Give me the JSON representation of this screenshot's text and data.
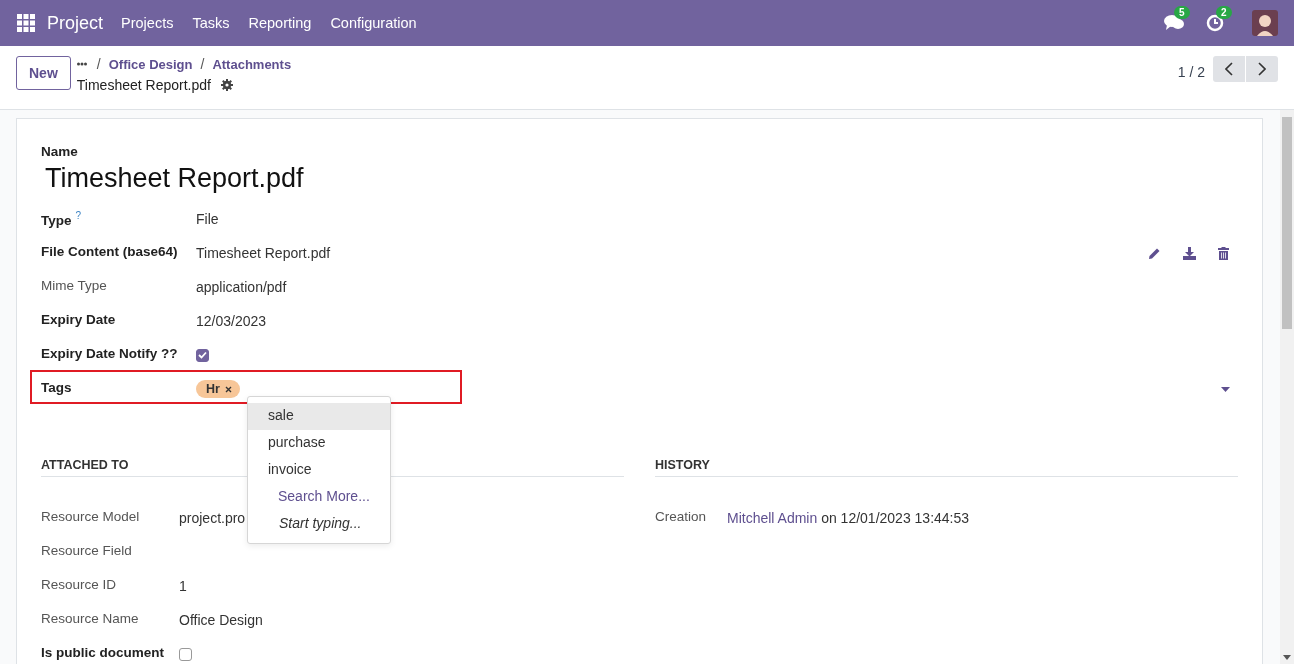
{
  "navbar": {
    "app": "Project",
    "menu": [
      "Projects",
      "Tasks",
      "Reporting",
      "Configuration"
    ],
    "messages_count": "5",
    "activities_count": "2"
  },
  "control_panel": {
    "new_button": "New",
    "breadcrumbs": [
      {
        "separator": "/",
        "label": "Office Design"
      },
      {
        "separator": "/",
        "label": "Attachments"
      }
    ],
    "record_title": "Timesheet Report.pdf",
    "pager": "1 / 2"
  },
  "form": {
    "name_label": "Name",
    "name": "Timesheet Report.pdf",
    "fields": [
      {
        "kind": "text",
        "label": "Type",
        "help": "?",
        "value": "File",
        "readonly": false
      },
      {
        "kind": "binary",
        "label": "File Content (base64)",
        "value": "Timesheet Report.pdf",
        "readonly": false
      },
      {
        "kind": "text",
        "label": "Mime Type",
        "value": "application/pdf",
        "readonly": true
      },
      {
        "kind": "text",
        "label": "Expiry Date",
        "value": "12/03/2023",
        "readonly": false
      },
      {
        "kind": "checkbox",
        "label": "Expiry Date Notify ??",
        "checked": true,
        "readonly": false
      },
      {
        "kind": "tags",
        "label": "Tags",
        "tags": [
          {
            "label": "Hr",
            "color": "#f7c698"
          }
        ],
        "highlighted": true,
        "readonly": false
      }
    ],
    "sections": [
      {
        "title": "ATTACHED TO",
        "fields": [
          {
            "kind": "text",
            "label": "Resource Model",
            "value": "project.pro",
            "readonly": true
          },
          {
            "kind": "text",
            "label": "Resource Field",
            "readonly": true
          },
          {
            "kind": "text",
            "label": "Resource ID",
            "value": "1",
            "readonly": true
          },
          {
            "kind": "text",
            "label": "Resource Name",
            "value": "Office Design",
            "readonly": true
          },
          {
            "kind": "checkbox",
            "label": "Is public document",
            "checked": false,
            "readonly": false
          }
        ]
      },
      {
        "title": "HISTORY",
        "fields": [
          {
            "kind": "creation",
            "label": "Creation",
            "user": "Mitchell Admin",
            "value": "on 12/01/2023 13:44:53",
            "readonly": true
          }
        ]
      }
    ]
  },
  "dropdown": [
    {
      "kind": "option",
      "label": "sale",
      "selected": true
    },
    {
      "kind": "option",
      "label": "purchase",
      "selected": false
    },
    {
      "kind": "option",
      "label": "invoice",
      "selected": false
    },
    {
      "kind": "search_more",
      "label": "Search More...",
      "selected": false
    },
    {
      "kind": "hint",
      "label": "Start typing...",
      "selected": false
    }
  ]
}
